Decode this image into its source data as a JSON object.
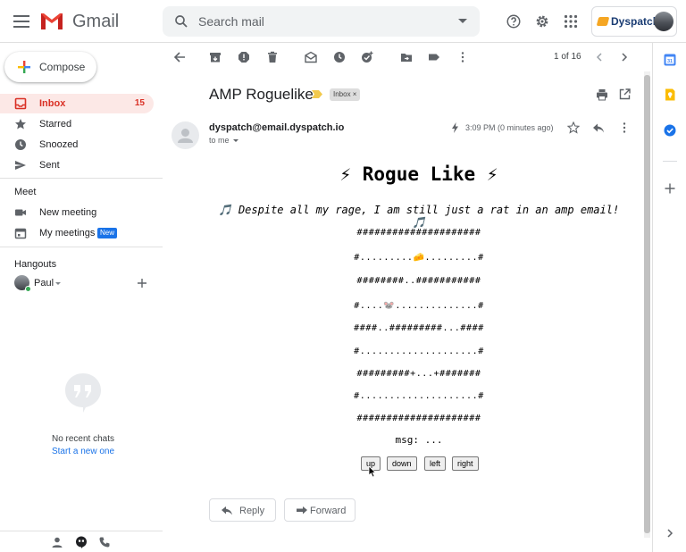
{
  "header": {
    "app_name": "Gmail",
    "search_placeholder": "Search mail",
    "brand_name": "Dyspatch"
  },
  "sidebar": {
    "compose_label": "Compose",
    "items": [
      {
        "label": "Inbox",
        "count": "15",
        "active": true
      },
      {
        "label": "Starred"
      },
      {
        "label": "Snoozed"
      },
      {
        "label": "Sent"
      }
    ],
    "meet": {
      "title": "Meet",
      "items": [
        {
          "label": "New meeting"
        },
        {
          "label": "My meetings",
          "badge": "New"
        }
      ]
    },
    "hangouts": {
      "title": "Hangouts",
      "user": "Paul",
      "empty_text": "No recent chats",
      "start_link": "Start a new one"
    }
  },
  "toolbar": {
    "pager": "1 of 16"
  },
  "email": {
    "subject": "AMP Roguelike",
    "label": "Inbox ×",
    "sender": "dyspatch@email.dyspatch.io",
    "to": "to me",
    "time": "3:09 PM (0 minutes ago)",
    "body": {
      "title": "⚡ Rogue Like ⚡",
      "quote": "🎵 Despite all my rage, I am still just a rat in an amp email! 🎵",
      "grid": [
        "#####################",
        "#.........🧀.........#",
        "########..###########",
        "#....🐭..............#",
        "####..#########...####",
        "#....................#",
        "#########+...+#######",
        "#....................#",
        "#####################"
      ],
      "msg": "msg: ...",
      "controls": [
        "up",
        "down",
        "left",
        "right"
      ]
    },
    "reply_label": "Reply",
    "forward_label": "Forward"
  },
  "colors": {
    "accent_red": "#d93025",
    "link_blue": "#1a73e8",
    "inbox_highlight": "#fce8e6"
  }
}
